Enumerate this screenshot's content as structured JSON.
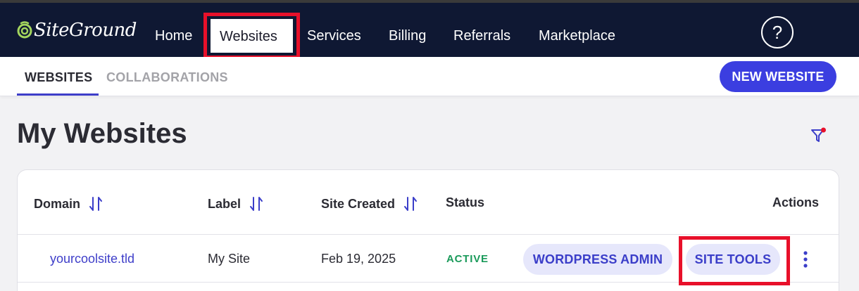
{
  "brand": {
    "name": "SiteGround"
  },
  "nav": {
    "items": [
      "Home",
      "Websites",
      "Services",
      "Billing",
      "Referrals",
      "Marketplace"
    ],
    "active": "Websites",
    "help_label": "?"
  },
  "subnav": {
    "tabs": [
      {
        "label": "WEBSITES",
        "active": true
      },
      {
        "label": "COLLABORATIONS",
        "active": false
      }
    ],
    "new_button": "NEW WEBSITE"
  },
  "page": {
    "title": "My Websites"
  },
  "table": {
    "headers": {
      "domain": "Domain",
      "label": "Label",
      "site_created": "Site Created",
      "status": "Status",
      "actions": "Actions"
    },
    "rows": [
      {
        "domain": "yourcoolsite.tld",
        "label": "My Site",
        "site_created": "Feb 19, 2025",
        "status": "ACTIVE",
        "wp_admin": "WORDPRESS ADMIN",
        "site_tools": "SITE TOOLS"
      }
    ]
  },
  "colors": {
    "navbar": "#0f1833",
    "accent": "#3b3ee0",
    "link": "#3e3ec9",
    "active_status": "#1a9a5a",
    "highlight": "#e8102a",
    "filter_dot": "#e8102a"
  },
  "icons": [
    "siteground-logo-icon",
    "help-icon",
    "filter-icon",
    "sort-icon",
    "more-vertical-icon"
  ]
}
